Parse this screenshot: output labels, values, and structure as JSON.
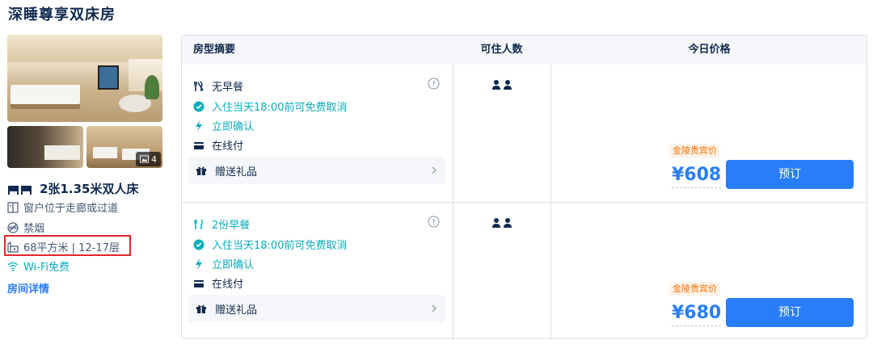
{
  "room": {
    "title": "深睡尊享双床房",
    "photo_count": "4",
    "facilities": {
      "bed": "2张1.35米双人床",
      "window": "窗户位于走廊或过道",
      "smoking": "禁烟",
      "area": "68平方米 | 12-17层",
      "wifi": "Wi-Fi免费"
    },
    "detail_link": "房间详情"
  },
  "table": {
    "headers": {
      "summary": "房型摘要",
      "occupancy": "可住人数",
      "price": "今日价格"
    },
    "rows": [
      {
        "meal": "无早餐",
        "cancel": "入住当天18:00前可免费取消",
        "confirm": "立即确认",
        "payment": "在线付",
        "gift": "赠送礼品",
        "tag": "金陵贵宾价",
        "price": "¥608",
        "book": "预订"
      },
      {
        "meal": "2份早餐",
        "cancel": "入住当天18:00前可免费取消",
        "confirm": "立即确认",
        "payment": "在线付",
        "gift": "赠送礼品",
        "tag": "金陵贵宾价",
        "price": "¥680",
        "book": "预订"
      }
    ]
  },
  "colors": {
    "primary": "#287dfa",
    "green": "#06aebd",
    "tag": "#ff6f00",
    "highlight": "#e4262b"
  }
}
